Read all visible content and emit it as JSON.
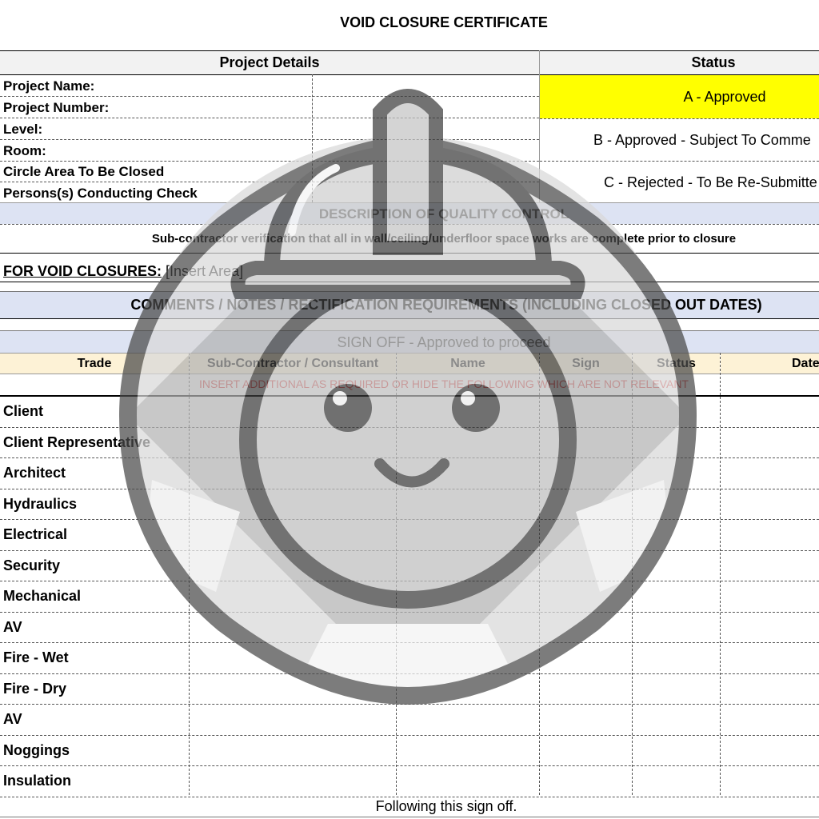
{
  "document": {
    "title": "VOID CLOSURE CERTIFICATE",
    "project_details_header": "Project Details",
    "status_header": "Status",
    "project_fields": [
      "Project Name:",
      "Project Number:",
      "Level:",
      "Room:",
      "Circle Area To Be Closed",
      "Persons(s) Conducting Check"
    ],
    "status_options": [
      {
        "label": "A - Approved",
        "color": "#ffff00"
      },
      {
        "label": "B - Approved - Subject To Comme",
        "color": "#ffffff"
      },
      {
        "label": "C - Rejected - To Be Re-Submitte",
        "color": "#ffffff"
      }
    ],
    "qc_header": "DESCRIPTION OF QUALITY CONTROL",
    "qc_text": "Sub-contractor verification that all in wall/ceiling/underfloor space works are complete prior to closure",
    "void_closures_label": "FOR VOID CLOSURES:",
    "void_closures_value": "[Insert Area]",
    "comments_header": "COMMENTS / NOTES / RECTIFICATION REQUIREMENTS (INCLUDING CLOSED OUT DATES)",
    "signoff_header": "SIGN OFF - Approved to proceed",
    "signoff_columns": [
      "Trade",
      "Sub-Contractor / Consultant",
      "Name",
      "Sign",
      "Status",
      "Date"
    ],
    "insert_note": "INSERT ADDITIONAL AS REQUIRED OR HIDE THE FOLLOWING WHICH ARE NOT RELEVANT",
    "trades": [
      "Client",
      "Client Representative",
      "Architect",
      "Hydraulics",
      "Electrical",
      "Security",
      "Mechanical",
      "AV",
      "Fire - Wet",
      "Fire - Dry",
      "AV",
      "Noggings",
      "Insulation"
    ],
    "footer": "Following this sign off.",
    "colors": {
      "approved_yellow": "#ffff00",
      "section_blue": "#dde3f3",
      "trade_header": "#fdf2d6",
      "insert_note_red": "#e04040"
    }
  },
  "watermark": {
    "icon": "hardhat-mascot-icon"
  }
}
